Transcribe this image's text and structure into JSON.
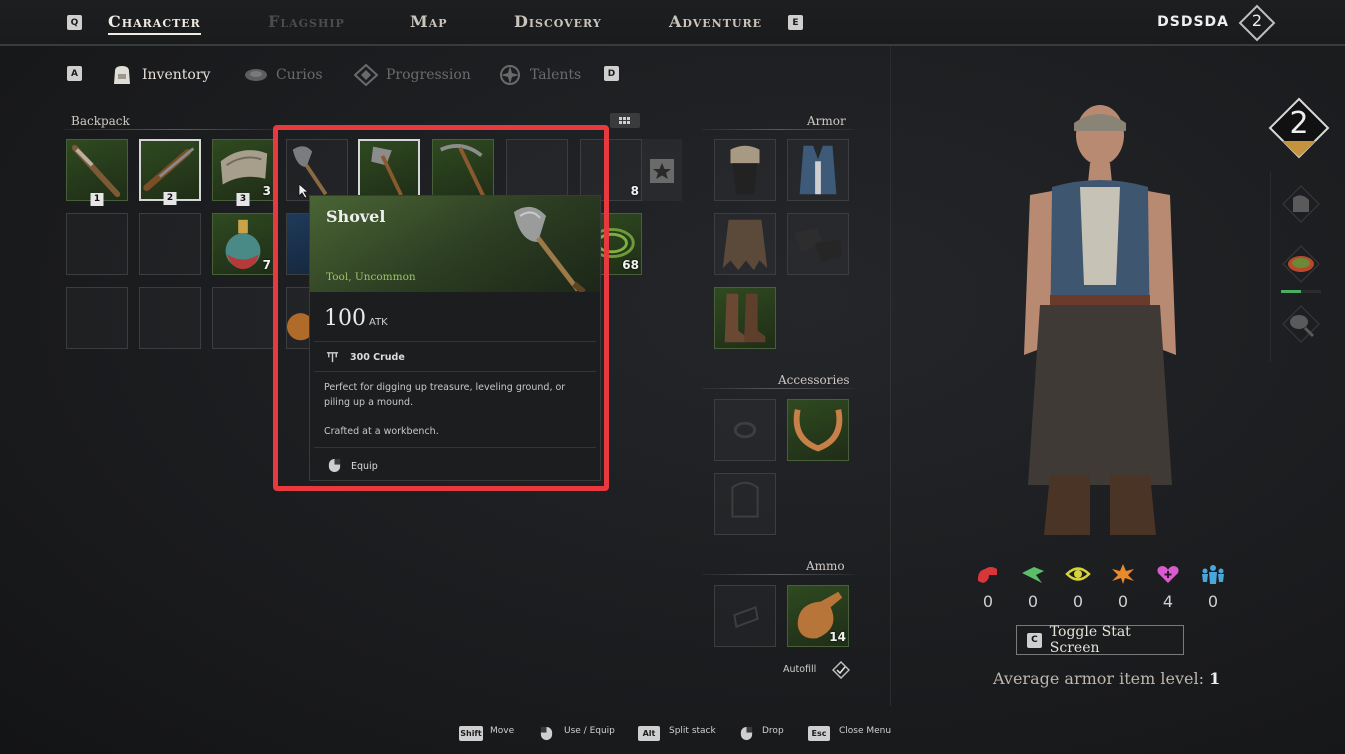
{
  "nav": {
    "left_key": "Q",
    "right_key": "E",
    "tabs": [
      {
        "label": "Character",
        "state": "active"
      },
      {
        "label": "Flagship",
        "state": "disabled"
      },
      {
        "label": "Map",
        "state": "normal"
      },
      {
        "label": "Discovery",
        "state": "normal"
      },
      {
        "label": "Adventure",
        "state": "normal"
      }
    ],
    "player_name": "DSDSDA",
    "player_level": "2"
  },
  "subnav": {
    "left_key": "A",
    "right_key": "D",
    "tabs": [
      {
        "label": "Inventory",
        "icon": "backpack-icon",
        "state": "active"
      },
      {
        "label": "Curios",
        "icon": "curios-icon",
        "state": "normal"
      },
      {
        "label": "Progression",
        "icon": "progression-icon",
        "state": "normal"
      },
      {
        "label": "Talents",
        "icon": "talents-icon",
        "state": "normal"
      }
    ]
  },
  "backpack": {
    "label": "Backpack",
    "hotbar_numbers": [
      "1",
      "2",
      "3"
    ],
    "counts": {
      "row1_col3": "3",
      "row1_col8": "8",
      "row2_col3": "7",
      "row2_col8": "68"
    }
  },
  "tooltip": {
    "title": "Shovel",
    "rarity": "Tool, Uncommon",
    "atk_value": "100",
    "atk_unit": "ATK",
    "cost": "300 Crude",
    "description": "Perfect for digging up treasure, leveling ground, or piling up a mound.",
    "crafted": "Crafted at a workbench.",
    "action": "Equip"
  },
  "equipment": {
    "armor_label": "Armor",
    "accessories_label": "Accessories",
    "ammo_label": "Ammo",
    "ammo_count": "14",
    "autofill_label": "Autofill"
  },
  "character": {
    "level": "2",
    "stats": [
      {
        "icon": "strength-icon",
        "value": "0",
        "color": "#d8363a"
      },
      {
        "icon": "dexterity-icon",
        "value": "0",
        "color": "#5bbf6a"
      },
      {
        "icon": "perception-icon",
        "value": "0",
        "color": "#d6d43a"
      },
      {
        "icon": "willpower-icon",
        "value": "0",
        "color": "#e88a2c"
      },
      {
        "icon": "vitality-icon",
        "value": "4",
        "color": "#d95bd0"
      },
      {
        "icon": "charisma-icon",
        "value": "0",
        "color": "#4aa6d8"
      }
    ],
    "toggle_key": "C",
    "toggle_label": "Toggle Stat Screen",
    "avg_label": "Average armor item level:",
    "avg_value": "1"
  },
  "footer": [
    {
      "key": "Shift",
      "label": "Move"
    },
    {
      "key": "",
      "label": "Use / Equip"
    },
    {
      "key": "Alt",
      "label": "Split stack"
    },
    {
      "key": "",
      "label": "Drop"
    },
    {
      "key": "Esc",
      "label": "Close Menu"
    }
  ]
}
